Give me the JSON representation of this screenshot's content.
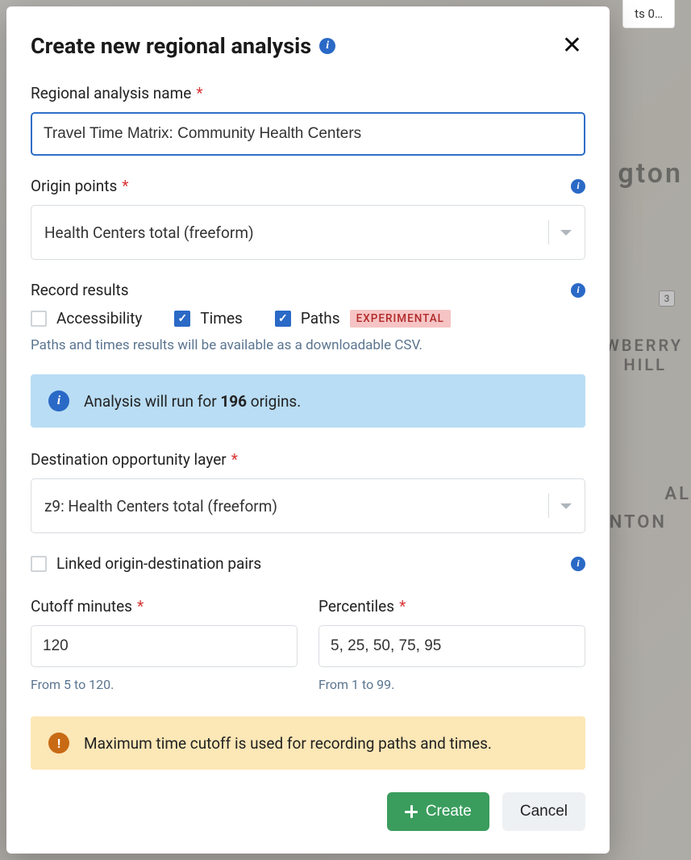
{
  "background": {
    "top_fragment": "ts 0…",
    "map_labels": [
      "gton",
      "WBERRY",
      "HILL",
      "AL",
      "NTON"
    ],
    "map_badge": "3"
  },
  "modal": {
    "title": "Create new regional analysis",
    "name_field": {
      "label": "Regional analysis name",
      "required": true,
      "value": "Travel Time Matrix: Community Health Centers"
    },
    "origin": {
      "label": "Origin points",
      "required": true,
      "value": "Health Centers total (freeform)"
    },
    "record_results": {
      "title": "Record results",
      "options": {
        "accessibility": {
          "label": "Accessibility",
          "checked": false
        },
        "times": {
          "label": "Times",
          "checked": true
        },
        "paths": {
          "label": "Paths",
          "checked": true,
          "badge": "EXPERIMENTAL"
        }
      },
      "helper": "Paths and times results will be available as a downloadable CSV."
    },
    "origin_info": {
      "prefix": "Analysis will run for ",
      "count": "196",
      "suffix": " origins."
    },
    "destination": {
      "label": "Destination opportunity layer",
      "required": true,
      "value": "z9: Health Centers total (freeform)"
    },
    "linked_pairs": {
      "label": "Linked origin-destination pairs",
      "checked": false
    },
    "cutoff": {
      "label": "Cutoff minutes",
      "required": true,
      "value": "120",
      "hint": "From 5 to 120."
    },
    "percentiles": {
      "label": "Percentiles",
      "required": true,
      "value": "5, 25, 50, 75, 95",
      "hint": "From 1 to 99."
    },
    "warning": "Maximum time cutoff is used for recording paths and times.",
    "buttons": {
      "create": "Create",
      "cancel": "Cancel"
    }
  }
}
